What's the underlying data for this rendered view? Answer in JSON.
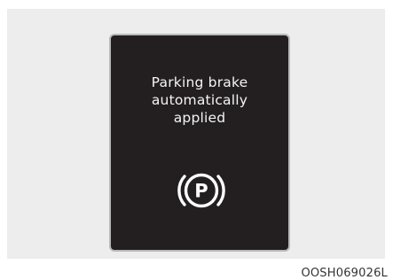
{
  "display": {
    "message_lines": [
      "Parking brake",
      "automatically",
      "applied"
    ],
    "icon": "parking-brake-icon",
    "icon_letter": "P"
  },
  "figure_code": "OOSH069026L"
}
